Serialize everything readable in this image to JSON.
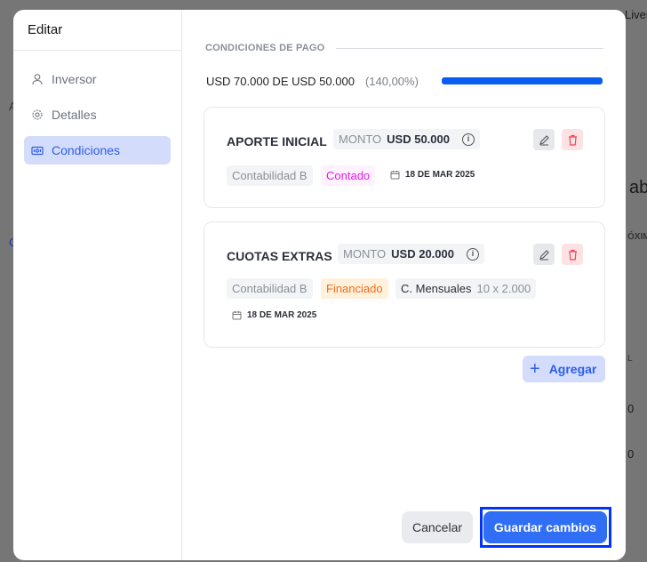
{
  "background": {
    "top_right": "Liver",
    "heading_fragment": "ab",
    "column_fragment": "ÓXIM",
    "col2": "L",
    "row1": "0",
    "row2": "0",
    "left1": "A",
    "left2": "C"
  },
  "modal": {
    "title": "Editar"
  },
  "sidebar": {
    "items": [
      {
        "label": "Inversor",
        "icon": "user-icon"
      },
      {
        "label": "Detalles",
        "icon": "gear-icon"
      },
      {
        "label": "Condiciones",
        "icon": "money-icon",
        "active": true
      }
    ]
  },
  "section": {
    "title": "CONDICIONES DE PAGO",
    "summary": "USD 70.000 DE USD 50.000",
    "percent": "(140,00%)",
    "progress": 1.0,
    "progress_color": "#0b5cf0"
  },
  "cards": [
    {
      "title": "APORTE INICIAL",
      "amount_label": "MONTO",
      "amount": "USD 50.000",
      "account": "Contabilidad B",
      "type": "Contado",
      "type_color": "#e01ee0",
      "date": "18 DE MAR 2025"
    },
    {
      "title": "CUOTAS EXTRAS",
      "amount_label": "MONTO",
      "amount": "USD 20.000",
      "account": "Contabilidad B",
      "type": "Financiado",
      "type_color": "#f26b1d",
      "installments_label": "C. Mensuales",
      "installments": "10 x 2.000",
      "date": "18 DE MAR 2025"
    }
  ],
  "actions": {
    "add": "Agregar",
    "cancel": "Cancelar",
    "save": "Guardar cambios"
  }
}
